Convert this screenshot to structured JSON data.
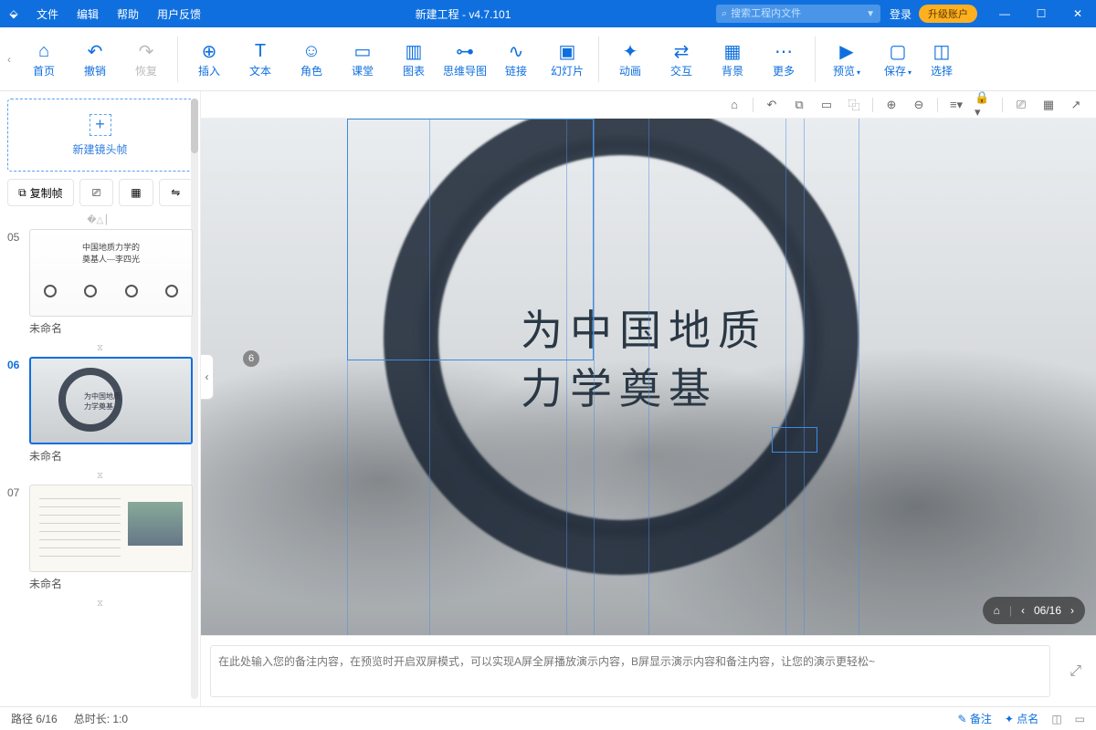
{
  "app": {
    "title": "新建工程 - v4.7.101"
  },
  "menu": {
    "file": "文件",
    "edit": "编辑",
    "help": "帮助",
    "feedback": "用户反馈"
  },
  "search": {
    "placeholder": "搜索工程内文件"
  },
  "account": {
    "login": "登录",
    "upgrade": "升级账户"
  },
  "ribbon": {
    "home": "首页",
    "undo": "撤销",
    "redo": "恢复",
    "insert": "插入",
    "text": "文本",
    "role": "角色",
    "class": "课堂",
    "chart": "图表",
    "mind": "思维导图",
    "link": "链接",
    "slide": "幻灯片",
    "anim": "动画",
    "interact": "交互",
    "bg": "背景",
    "more": "更多",
    "preview": "预览",
    "save": "保存",
    "select": "选择"
  },
  "sidebar": {
    "newframe": "新建镜头帧",
    "copy": "复制帧",
    "slides": [
      {
        "num": "05",
        "name": "未命名",
        "title": "中国地质力学的\n奠基人—李四光"
      },
      {
        "num": "06",
        "name": "未命名",
        "title": "为中国地质\n力学奠基"
      },
      {
        "num": "07",
        "name": "未命名"
      }
    ]
  },
  "canvas": {
    "text_line1": "为中国地质",
    "text_line2": "力学奠基",
    "tag": "6",
    "pager": "06/16"
  },
  "notes": {
    "placeholder": "在此处输入您的备注内容，在预览时开启双屏模式，可以实现A屏全屏播放演示内容，B屏显示演示内容和备注内容，让您的演示更轻松~"
  },
  "status": {
    "path": "路径 6/16",
    "duration": "总时长: 1:0",
    "note": "备注",
    "like": "点名"
  }
}
